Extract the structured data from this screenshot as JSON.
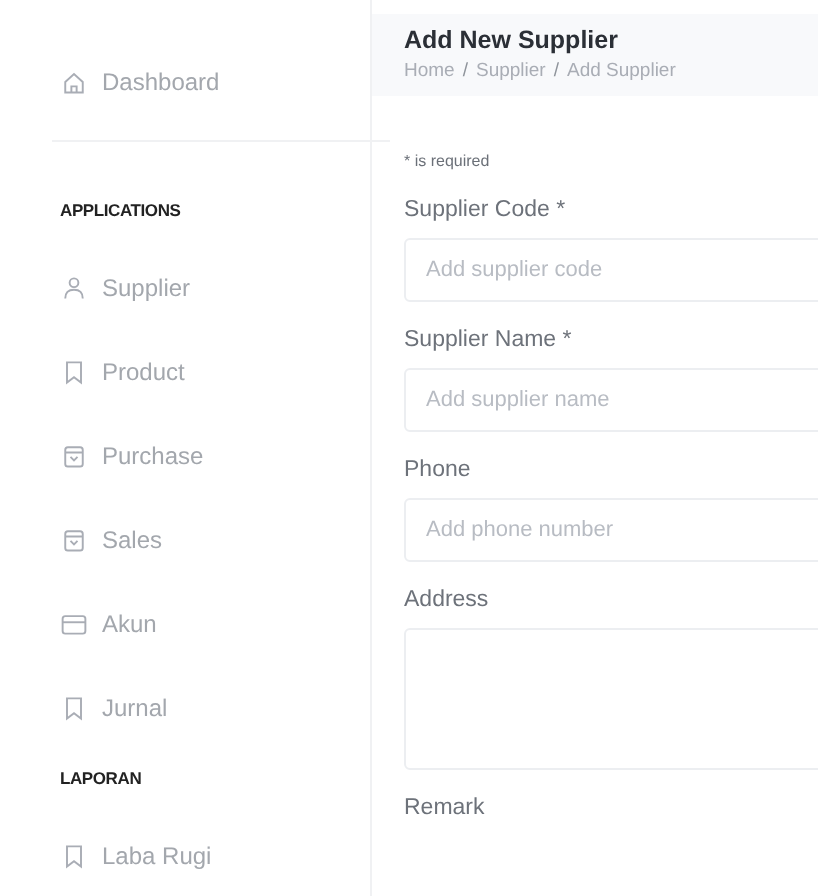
{
  "sidebar": {
    "items": [
      {
        "kind": "item",
        "label": "Dashboard"
      },
      {
        "kind": "divider"
      },
      {
        "kind": "heading",
        "label": "APPLICATIONS"
      },
      {
        "kind": "item",
        "label": "Supplier"
      },
      {
        "kind": "item",
        "label": "Product"
      },
      {
        "kind": "item",
        "label": "Purchase"
      },
      {
        "kind": "item",
        "label": "Sales"
      },
      {
        "kind": "item",
        "label": "Akun"
      },
      {
        "kind": "item",
        "label": "Jurnal"
      },
      {
        "kind": "heading",
        "label": "LAPORAN"
      },
      {
        "kind": "item",
        "label": "Laba Rugi"
      }
    ]
  },
  "header": {
    "title": "Add New Supplier",
    "breadcrumb": [
      "Home",
      "Supplier",
      "Add Supplier"
    ],
    "separators": [
      "/",
      "/"
    ]
  },
  "form": {
    "note": "* is required",
    "fields": [
      {
        "kind": "input",
        "label": "Supplier Code *",
        "placeholder": "Add supplier code"
      },
      {
        "kind": "input",
        "label": "Supplier Name *",
        "placeholder": "Add supplier name"
      },
      {
        "kind": "input",
        "label": "Phone",
        "placeholder": "Add phone number"
      },
      {
        "kind": "textarea",
        "label": "Address"
      },
      {
        "kind": "none",
        "label": "Remark"
      }
    ]
  }
}
